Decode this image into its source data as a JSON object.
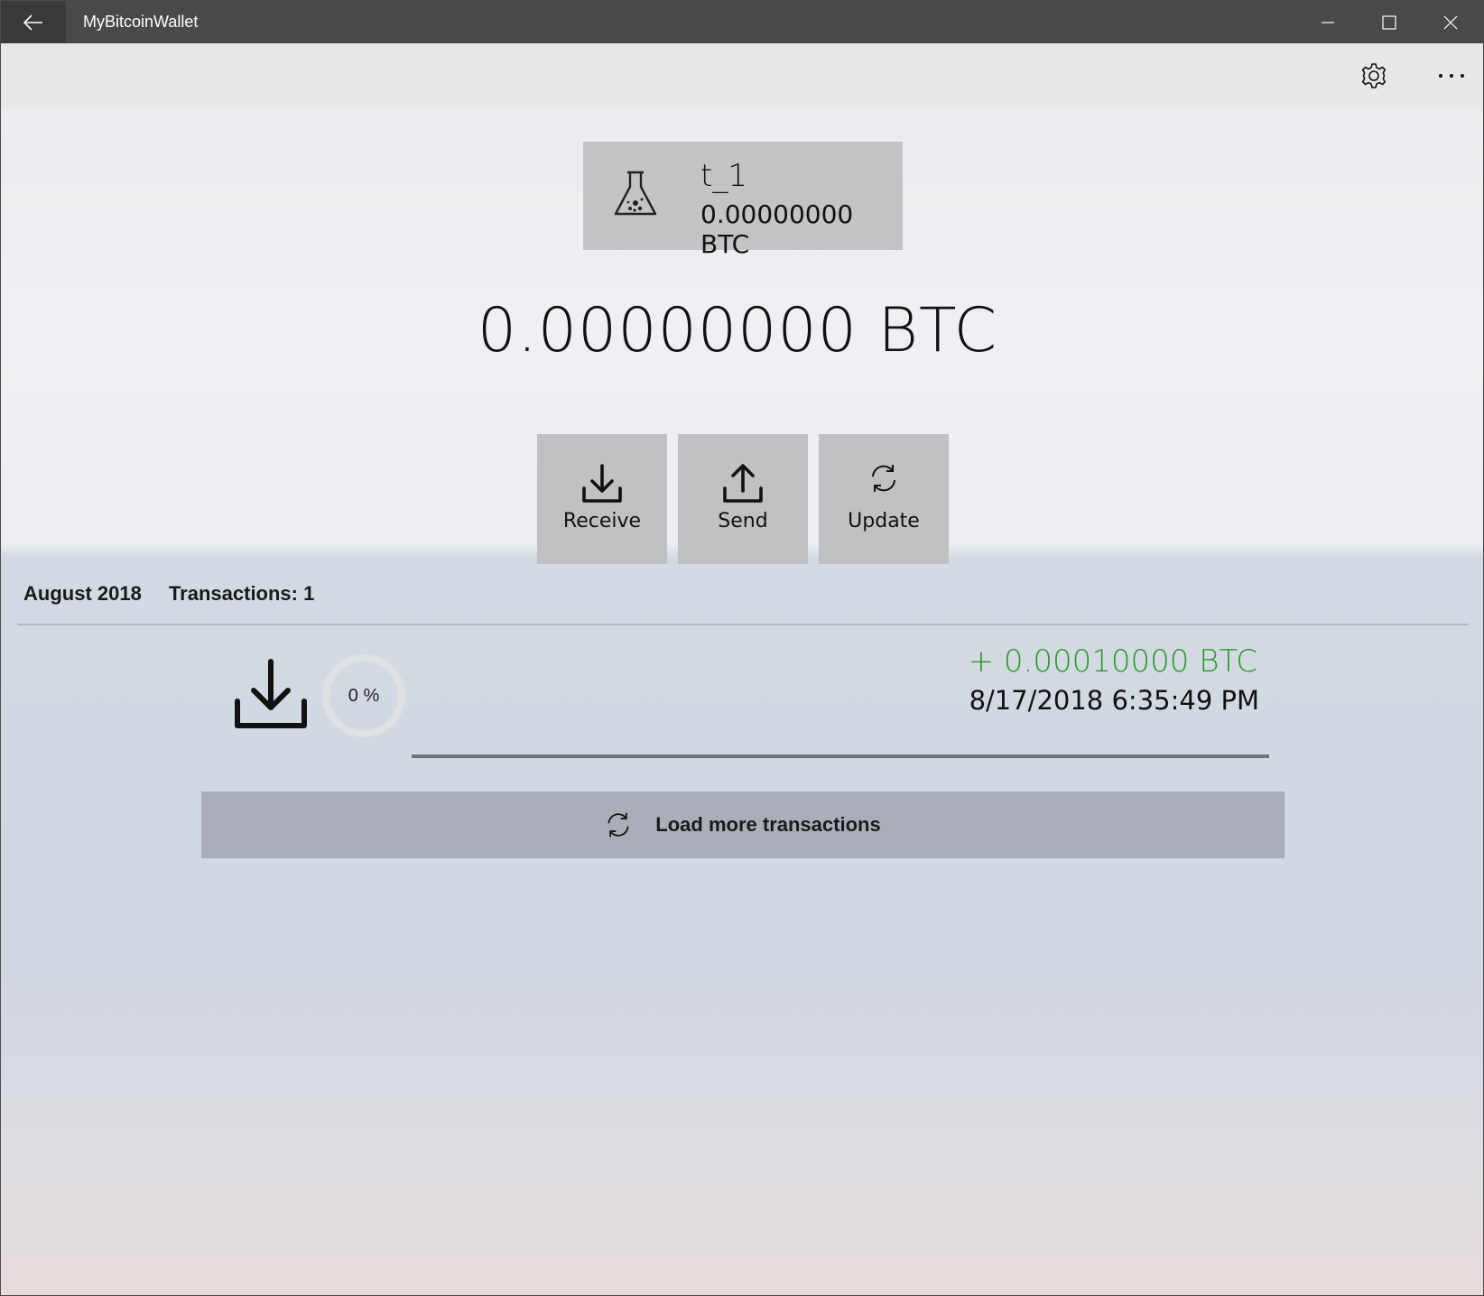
{
  "window": {
    "title": "MyBitcoinWallet"
  },
  "wallet": {
    "name": "t_1",
    "balance": "0.00000000 BTC",
    "icon": "flask-icon"
  },
  "total_balance": "0.00000000 BTC",
  "actions": [
    {
      "label": "Receive",
      "icon": "download-icon"
    },
    {
      "label": "Send",
      "icon": "upload-icon"
    },
    {
      "label": "Update",
      "icon": "refresh-icon"
    }
  ],
  "transactions_section": {
    "month": "August 2018",
    "count_label": "Transactions: 1",
    "items": [
      {
        "direction_icon": "download-icon",
        "progress": "0 %",
        "amount": "+ 0.00010000 BTC",
        "date": "8/17/2018 6:35:49 PM"
      }
    ],
    "load_more_label": "Load more transactions"
  },
  "colors": {
    "titlebar": "#4a4948",
    "incoming_amount": "#2a9a2a",
    "button_bg": "#c0c1c3",
    "load_more_bg": "#a9aeb8"
  }
}
